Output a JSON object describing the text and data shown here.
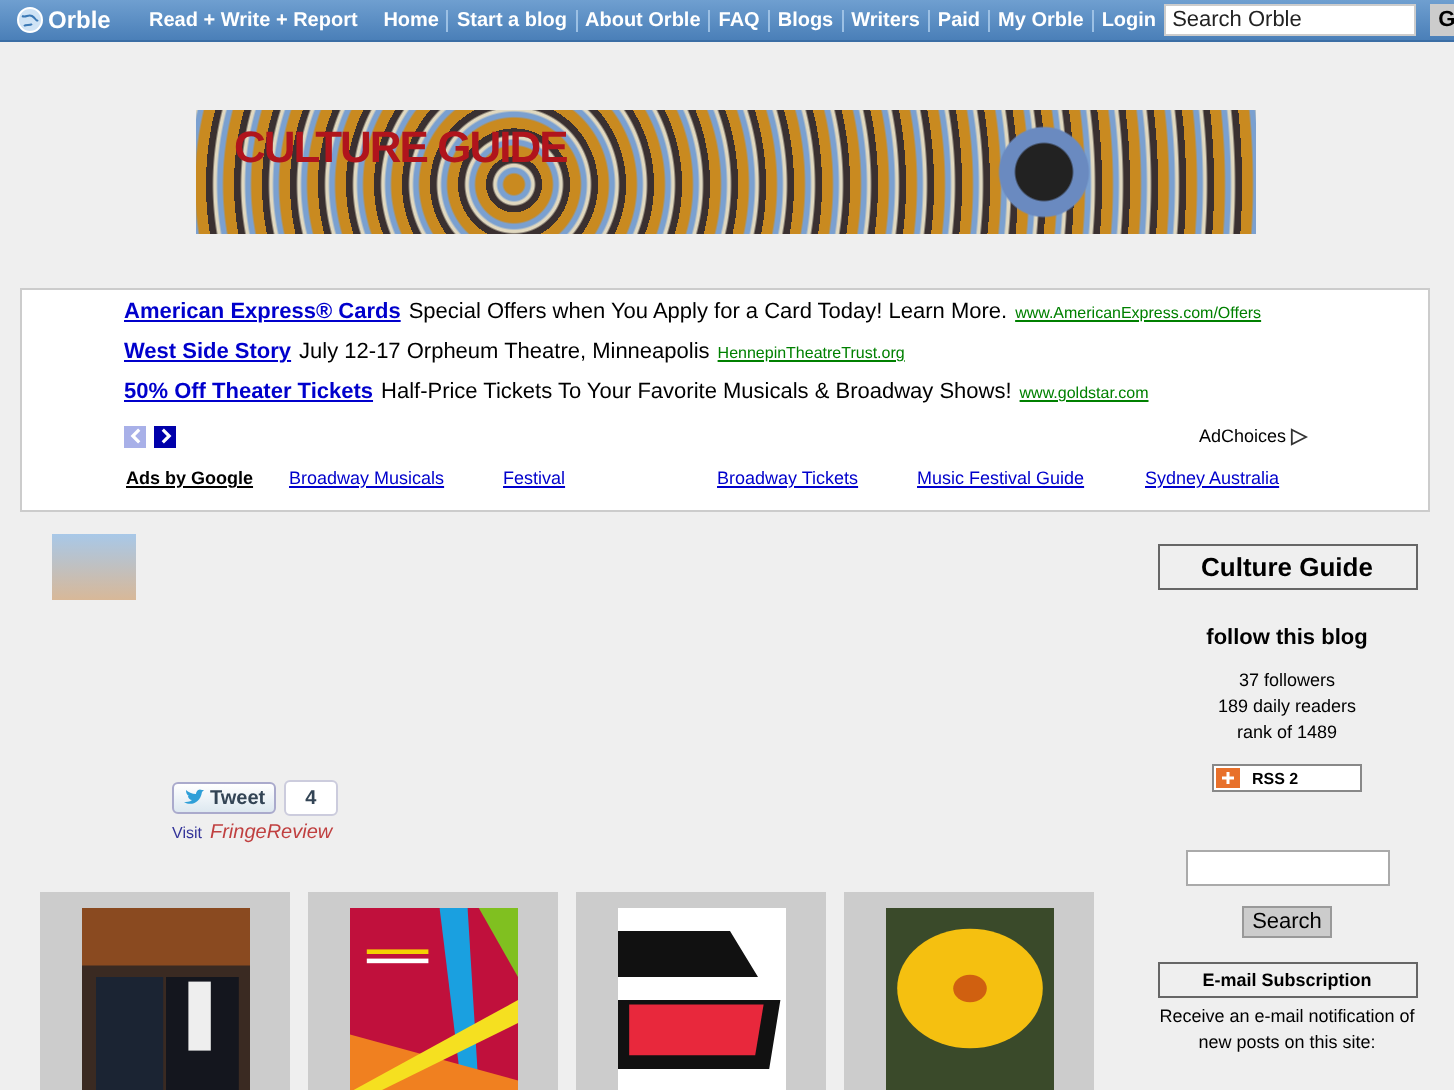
{
  "top_bar": {
    "logo": "Orble",
    "tagline": "Read + Write + Report",
    "nav": [
      "Home",
      "Start a blog",
      "About Orble",
      "FAQ",
      "Blogs",
      "Writers",
      "Paid",
      "My Orble",
      "Login"
    ],
    "search": {
      "placeholder": "Search Orble"
    },
    "search_button": "G"
  },
  "banner": {
    "title": "CULTURE GUIDE"
  },
  "ads": {
    "items": [
      {
        "title": "American Express® Cards",
        "text": "Special Offers when You Apply for a Card Today! Learn More.",
        "url": "www.AmericanExpress.com/Offers"
      },
      {
        "title": "West Side Story",
        "text": "July 12-17 Orpheum Theatre, Minneapolis",
        "url": "HennepinTheatreTrust.org"
      },
      {
        "title": "50% Off Theater Tickets",
        "text": "Half-Price Tickets To Your Favorite Musicals & Broadway Shows!",
        "url": "www.goldstar.com"
      }
    ],
    "adchoices": "AdChoices",
    "ads_by": "Ads by Google",
    "links": [
      "Broadway Musicals",
      "Festival",
      "Broadway Tickets",
      "Music Festival Guide",
      "Sydney Australia"
    ]
  },
  "post": {
    "tweet": "Tweet",
    "tweet_count": "4",
    "visit": "Visit",
    "visit_link": "FringeReview"
  },
  "thumbnails": [
    {
      "kind": "photo"
    },
    {
      "kind": "poster"
    },
    {
      "kind": "lettering"
    },
    {
      "kind": "flower"
    }
  ],
  "sidebar": {
    "title": "Culture Guide",
    "follow": "follow this blog",
    "stats": [
      "37 followers",
      "189 daily readers",
      "rank of 1489"
    ],
    "rss": "RSS 2",
    "search_button": "Search",
    "subscription_title": "E-mail Subscription",
    "subscription_text": "Receive an e-mail notification of new posts on this site:"
  }
}
